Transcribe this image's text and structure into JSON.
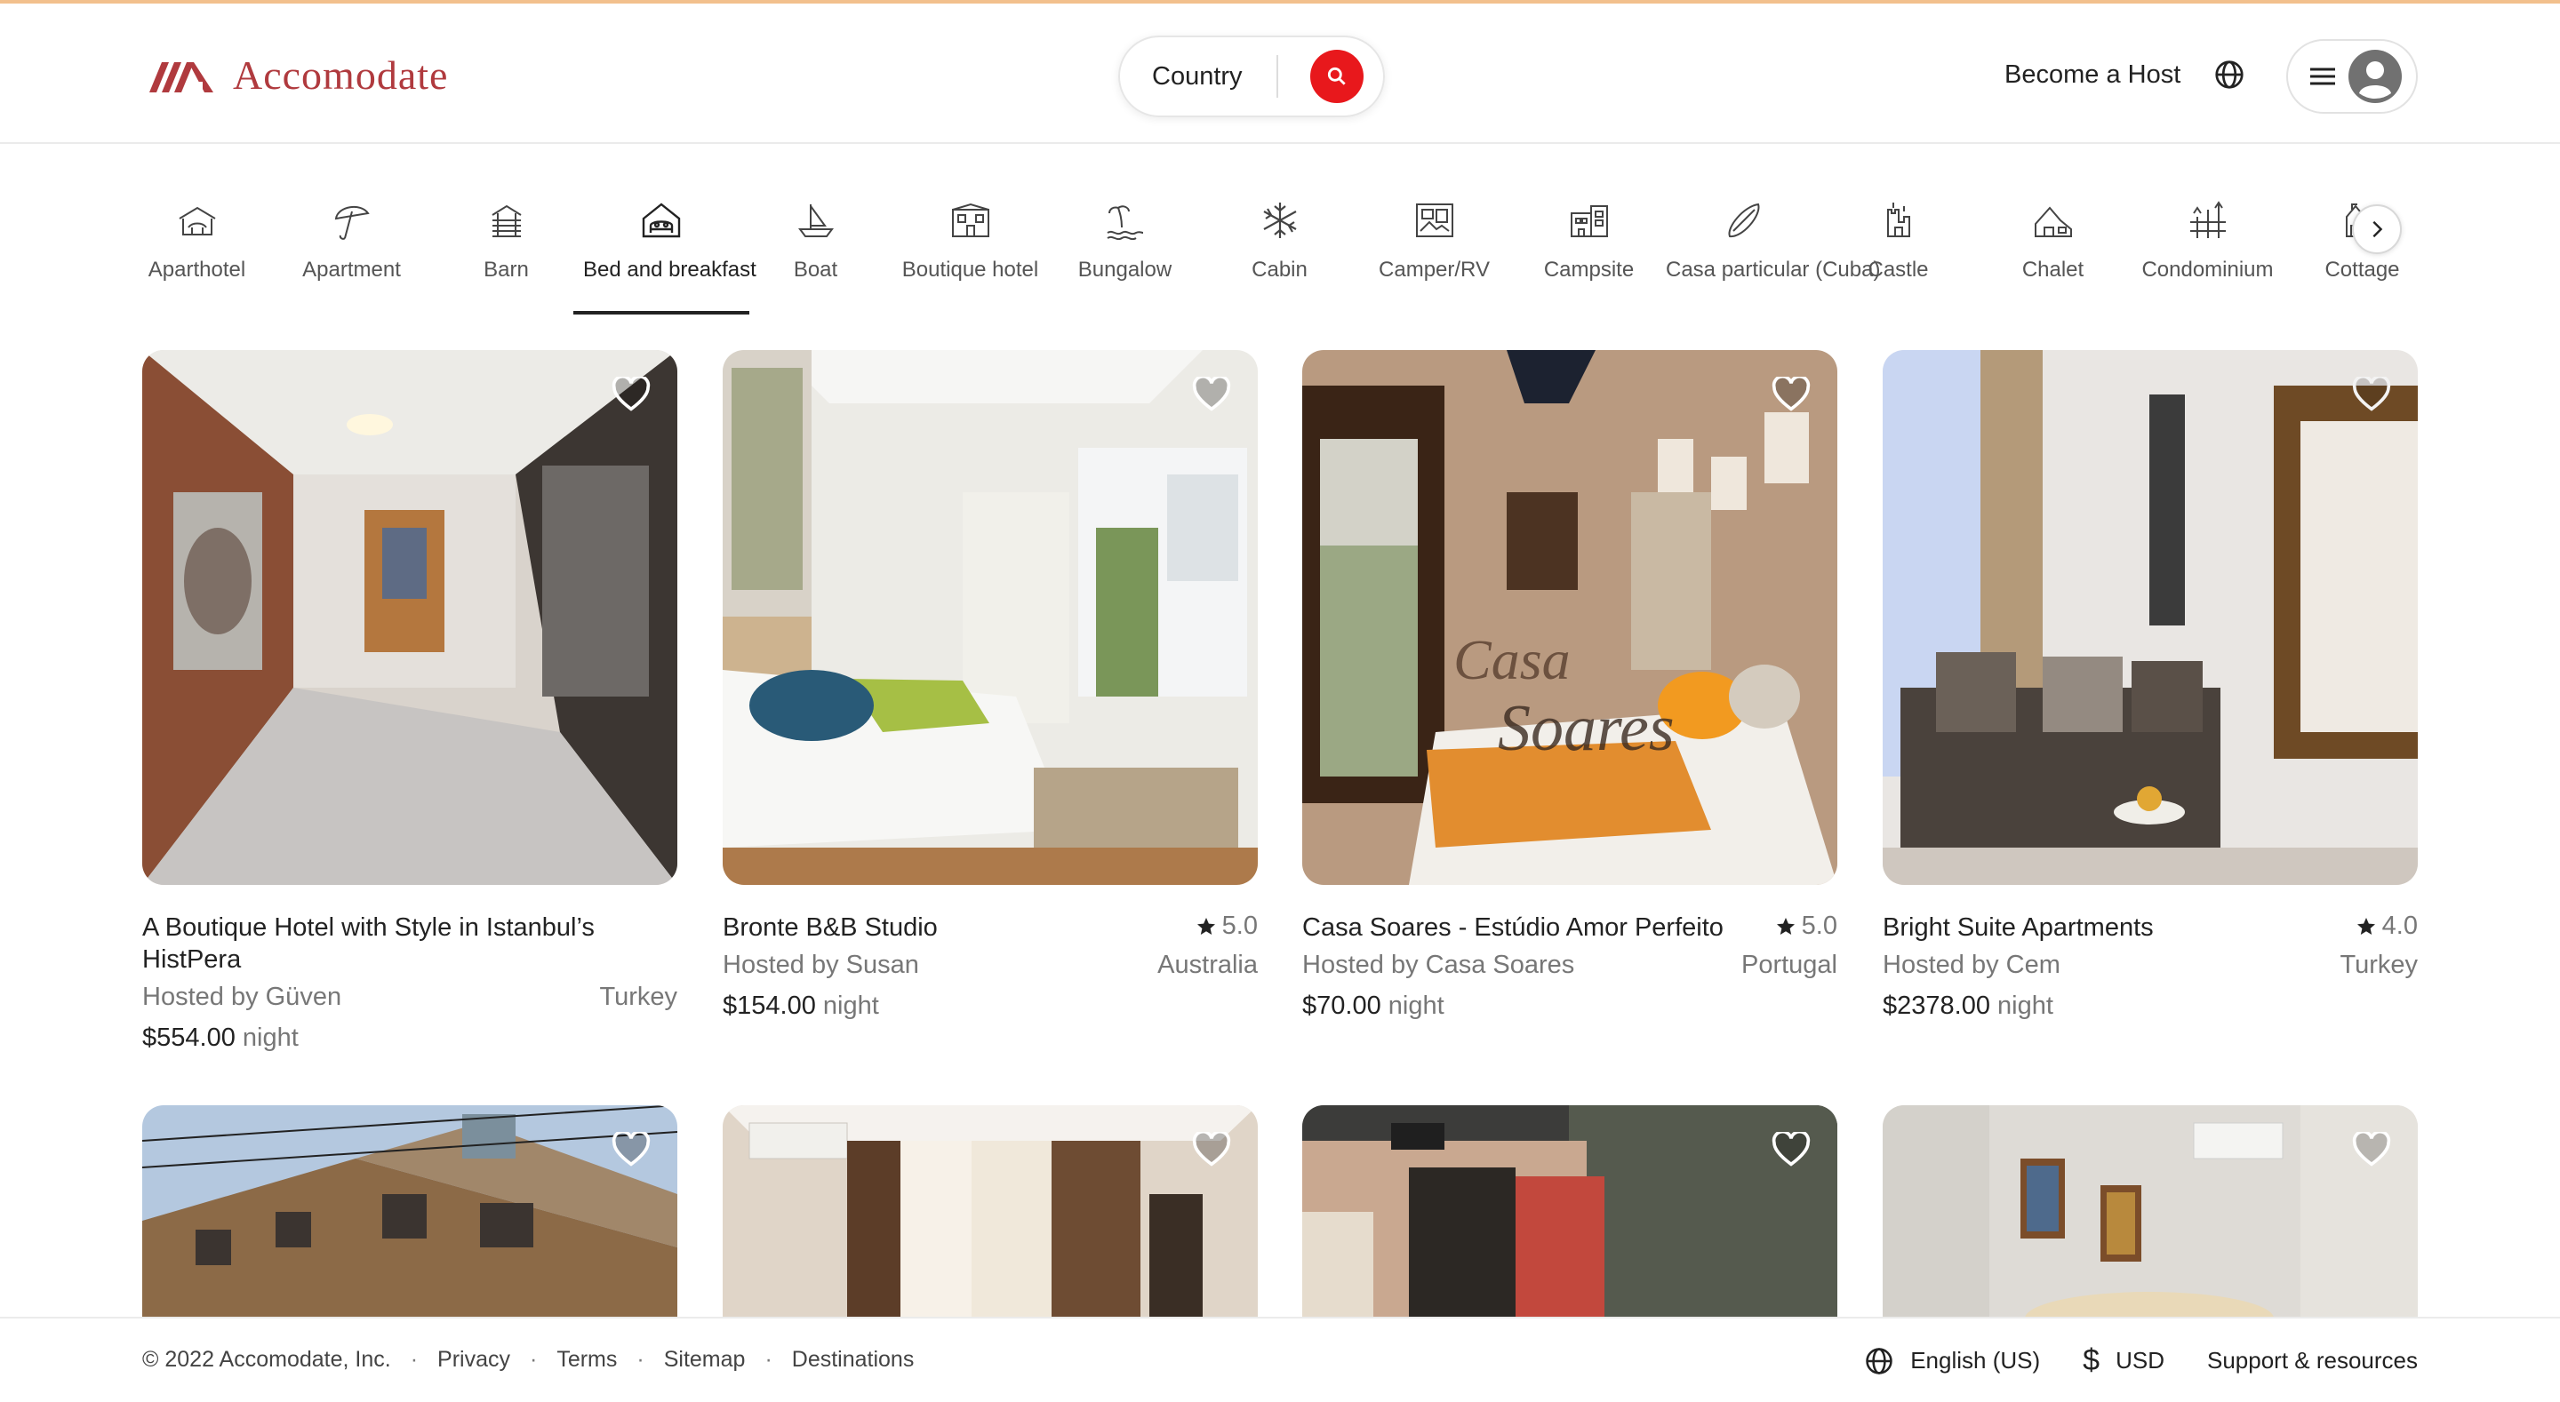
{
  "brand": {
    "name": "Accomodate",
    "color": "#b03a3e"
  },
  "search": {
    "label": "Country",
    "button_icon": "search-icon",
    "accent": "#e8181c"
  },
  "nav": {
    "host_label": "Become a Host",
    "globe_icon": "globe-icon",
    "menu_icon": "hamburger-icon",
    "avatar_icon": "user-avatar-icon"
  },
  "categories": [
    {
      "label": "Aparthotel",
      "icon": "aparthotel-icon"
    },
    {
      "label": "Apartment",
      "icon": "umbrella-icon"
    },
    {
      "label": "Barn",
      "icon": "barn-icon"
    },
    {
      "label": "Bed and breakfast",
      "icon": "bed-and-breakfast-icon",
      "active": true
    },
    {
      "label": "Boat",
      "icon": "boat-icon"
    },
    {
      "label": "Boutique hotel",
      "icon": "boutique-hotel-icon"
    },
    {
      "label": "Bungalow",
      "icon": "bungalow-icon"
    },
    {
      "label": "Cabin",
      "icon": "snowflake-icon"
    },
    {
      "label": "Camper/RV",
      "icon": "camper-icon"
    },
    {
      "label": "Campsite",
      "icon": "campsite-icon"
    },
    {
      "label": "Casa particular (Cuba)",
      "icon": "surfboard-icon"
    },
    {
      "label": "Castle",
      "icon": "castle-icon"
    },
    {
      "label": "Chalet",
      "icon": "chalet-icon"
    },
    {
      "label": "Condominium",
      "icon": "condominium-icon"
    },
    {
      "label": "Cottage",
      "icon": "cottage-icon"
    }
  ],
  "listings": [
    {
      "title": "A Boutique Hotel with Style in Istanbul’s HistPera",
      "rating": "",
      "host": "Hosted by Güven",
      "country": "Turkey",
      "price": "$554.00",
      "unit": "night"
    },
    {
      "title": "Bronte B&B Studio",
      "rating": "5.0",
      "host": "Hosted by Susan",
      "country": "Australia",
      "price": "$154.00",
      "unit": "night"
    },
    {
      "title": "Casa Soares - Estúdio Amor Perfeito",
      "rating": "5.0",
      "host": "Hosted by Casa Soares",
      "country": "Portugal",
      "price": "$70.00",
      "unit": "night"
    },
    {
      "title": "Bright Suite Apartments",
      "rating": "4.0",
      "host": "Hosted by Cem",
      "country": "Turkey",
      "price": "$2378.00",
      "unit": "night"
    }
  ],
  "footer": {
    "copyright": "© 2022 Accomodate, Inc.",
    "links": [
      "Privacy",
      "Terms",
      "Sitemap",
      "Destinations"
    ],
    "separator": "·",
    "language": "English (US)",
    "currency_symbol": "$",
    "currency": "USD",
    "support": "Support & resources"
  }
}
